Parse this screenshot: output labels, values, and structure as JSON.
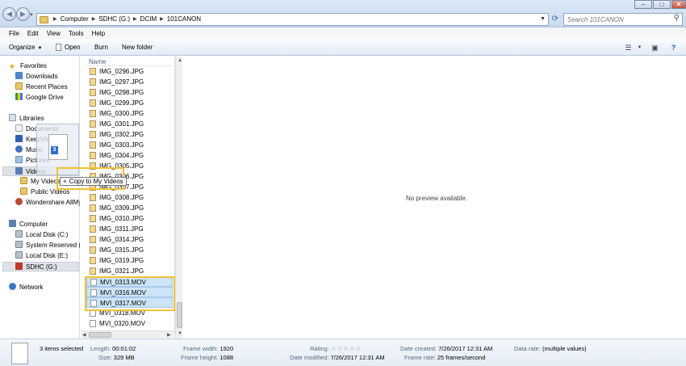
{
  "address": {
    "crumbs": [
      "Computer",
      "SDHC (G:)",
      "DCIM",
      "101CANON"
    ],
    "search_placeholder": "Search 101CANON"
  },
  "menu": [
    "File",
    "Edit",
    "View",
    "Tools",
    "Help"
  ],
  "toolbar": {
    "organize": "Organize",
    "open": "Open",
    "burn": "Burn",
    "new_folder": "New folder"
  },
  "nav": {
    "favorites": "Favorites",
    "downloads": "Downloads",
    "recent_places": "Recent Places",
    "google_drive": "Google Drive",
    "libraries": "Libraries",
    "documents": "Documents",
    "keepvid": "KeepVid Pro",
    "music": "Music",
    "pictures": "Pictures",
    "videos": "Videos",
    "my_videos": "My Videos",
    "public_videos": "Public Videos",
    "wondershare": "Wondershare AllMy",
    "computer": "Computer",
    "local_c": "Local Disk (C:)",
    "system_reserved": "System Reserved (D:",
    "local_e": "Local Disk (E:)",
    "sdhc": "SDHC (G:)",
    "network": "Network"
  },
  "filelist": {
    "column_name": "Name",
    "files": [
      "IMG_0296.JPG",
      "IMG_0297.JPG",
      "IMG_0298.JPG",
      "IMG_0299.JPG",
      "IMG_0300.JPG",
      "IMG_0301.JPG",
      "IMG_0302.JPG",
      "IMG_0303.JPG",
      "IMG_0304.JPG",
      "IMG_0305.JPG",
      "IMG_0306.JPG",
      "IMG_0307.JPG",
      "IMG_0308.JPG",
      "IMG_0309.JPG",
      "IMG_0310.JPG",
      "IMG_0311.JPG",
      "IMG_0314.JPG",
      "IMG_0315.JPG",
      "IMG_0319.JPG",
      "IMG_0321.JPG",
      "MVI_0313.MOV",
      "MVI_0316.MOV",
      "MVI_0317.MOV",
      "MVI_0318.MOV",
      "MVI_0320.MOV"
    ]
  },
  "preview": {
    "text": "No preview available."
  },
  "drag": {
    "count": "3",
    "tooltip": "Copy to My Videos"
  },
  "status": {
    "items_selected": "3 items selected",
    "length_label": "Length:",
    "length_value": "00:01:02",
    "size_label": "Size:",
    "size_value": "329 MB",
    "frame_width_label": "Frame width:",
    "frame_width_value": "1920",
    "frame_height_label": "Frame height:",
    "frame_height_value": "1088",
    "rating_label": "Rating:",
    "date_modified_label": "Date modified:",
    "date_modified_value": "7/26/2017 12:31 AM",
    "date_created_label": "Date created:",
    "date_created_value": "7/26/2017 12:31 AM",
    "frame_rate_label": "Frame rate:",
    "frame_rate_value": "25 frames/second",
    "data_rate_label": "Data rate:",
    "data_rate_value": "(multiple values)",
    "rating_stars": 0
  },
  "colors": {
    "selection": "#cde3f7",
    "highlight_box": "#f0c230"
  },
  "icons": {
    "favorites": "star-icon",
    "downloads": "downloads-icon",
    "folder": "folder-icon",
    "network": "network-icon"
  }
}
